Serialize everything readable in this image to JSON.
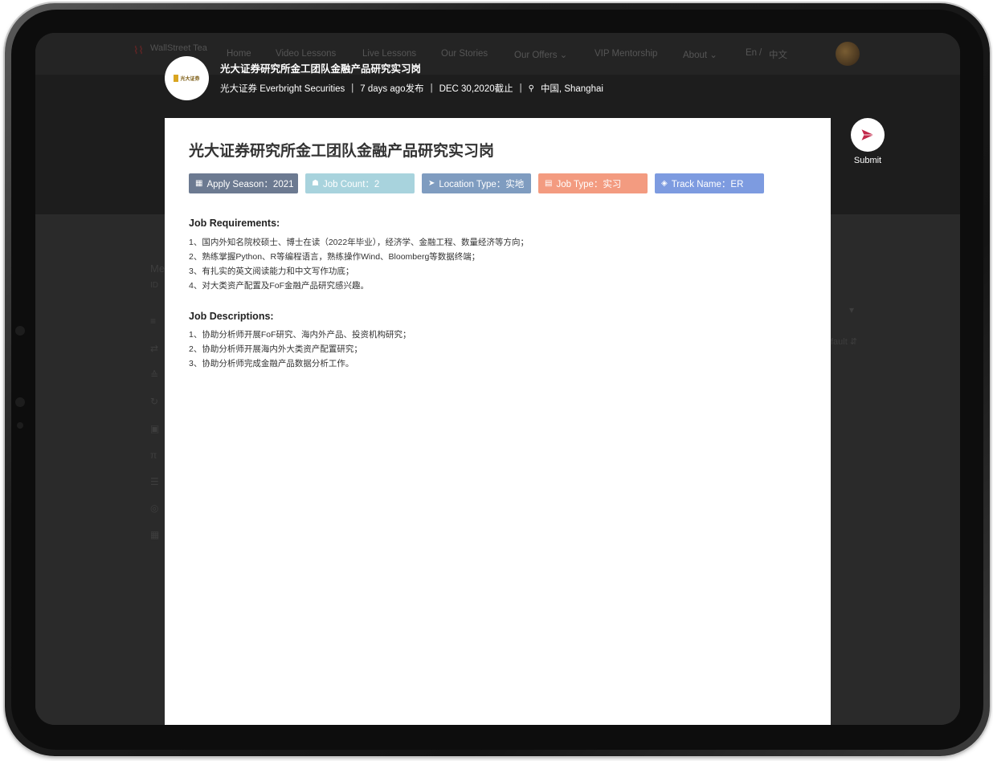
{
  "nav": {
    "logo_text": "WallStreet Tea",
    "items": [
      "Home",
      "Video Lessons",
      "Live Lessons",
      "Our Stories",
      "Our Offers ⌄",
      "VIP Mentorship",
      "About ⌄",
      "En",
      "/",
      "中文"
    ]
  },
  "background_page": {
    "fragments": [
      "Me",
      "ID",
      "▾",
      "fault ⇵"
    ]
  },
  "job_header": {
    "company_logo_text": "光大证券",
    "title": "光大证券研究所金工团队金融产品研究实习岗",
    "company": "光大证券 Everbright Securities",
    "posted": "7 days ago发布",
    "deadline": "DEC 30,2020截止",
    "location": "中国, Shanghai"
  },
  "modal": {
    "title": "光大证券研究所金工团队金融产品研究实习岗",
    "tags": [
      {
        "label": "Apply Season：2021",
        "icon": "calendar-icon",
        "color": "#6c7a91"
      },
      {
        "label": "Job Count：2",
        "icon": "people-icon",
        "color": "#a8d3dd"
      },
      {
        "label": "Location Type：实地",
        "icon": "location-arrow-icon",
        "color": "#7f9cc0"
      },
      {
        "label": "Job Type：实习",
        "icon": "chart-icon",
        "color": "#f39b80"
      },
      {
        "label": "Track Name：ER",
        "icon": "cube-icon",
        "color": "#7d9be0"
      }
    ],
    "requirements_title": "Job Requirements:",
    "requirements": [
      "1、国内外知名院校硕士、博士在读（2022年毕业），经济学、金融工程、数量经济等方向；",
      "2、熟练掌握Python、R等编程语言，熟练操作Wind、Bloomberg等数据终端；",
      "3、有扎实的英文阅读能力和中文写作功底；",
      "4、对大类资产配置及FoF金融产品研究感兴趣。"
    ],
    "descriptions_title": "Job Descriptions:",
    "descriptions": [
      "1、协助分析师开展FoF研究、海内外产品、投资机构研究；",
      "2、协助分析师开展海内外大类资产配置研究；",
      "3、协助分析师完成金融产品数据分析工作。"
    ]
  },
  "submit": {
    "label": "Submit",
    "icon": "paper-plane-icon",
    "color": "#c2294a"
  }
}
